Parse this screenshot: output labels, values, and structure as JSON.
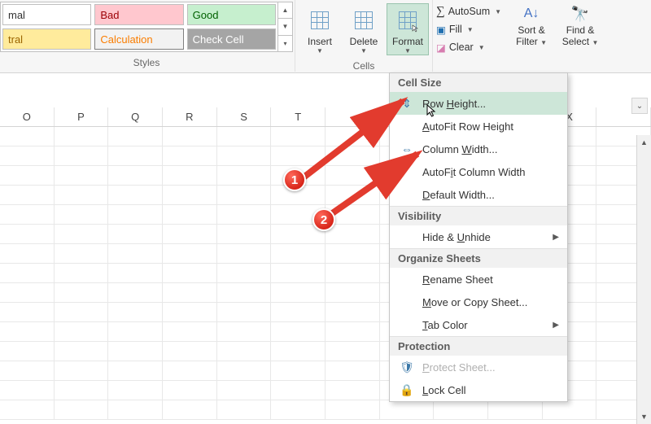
{
  "styles_gallery": {
    "row1": [
      "mal",
      "Bad",
      "Good"
    ],
    "row2": [
      "tral",
      "Calculation",
      "Check Cell"
    ],
    "group_label": "Styles"
  },
  "cells_group": {
    "insert": "Insert",
    "delete": "Delete",
    "format": "Format",
    "group_label": "Cells"
  },
  "editing_group": {
    "autosum": "AutoSum",
    "fill": "Fill",
    "clear": "Clear",
    "sort_filter_line1": "Sort &",
    "sort_filter_line2": "Filter",
    "find_select_line1": "Find &",
    "find_select_line2": "Select"
  },
  "columns": [
    "O",
    "P",
    "Q",
    "R",
    "S",
    "T",
    "",
    "",
    "",
    "",
    "X"
  ],
  "dropdown": {
    "headers": {
      "cell_size": "Cell Size",
      "visibility": "Visibility",
      "organize": "Organize Sheets",
      "protection": "Protection"
    },
    "items": {
      "row_height": "Row Height...",
      "autofit_row": "AutoFit Row Height",
      "col_width": "Column Width...",
      "autofit_col": "AutoFit Column Width",
      "default_width": "Default Width...",
      "hide_unhide": "Hide & Unhide",
      "rename_sheet": "Rename Sheet",
      "move_copy": "Move or Copy Sheet...",
      "tab_color": "Tab Color",
      "protect_sheet": "Protect Sheet...",
      "lock_cell": "Lock Cell"
    }
  },
  "annotations": {
    "b1": "1",
    "b2": "2"
  }
}
